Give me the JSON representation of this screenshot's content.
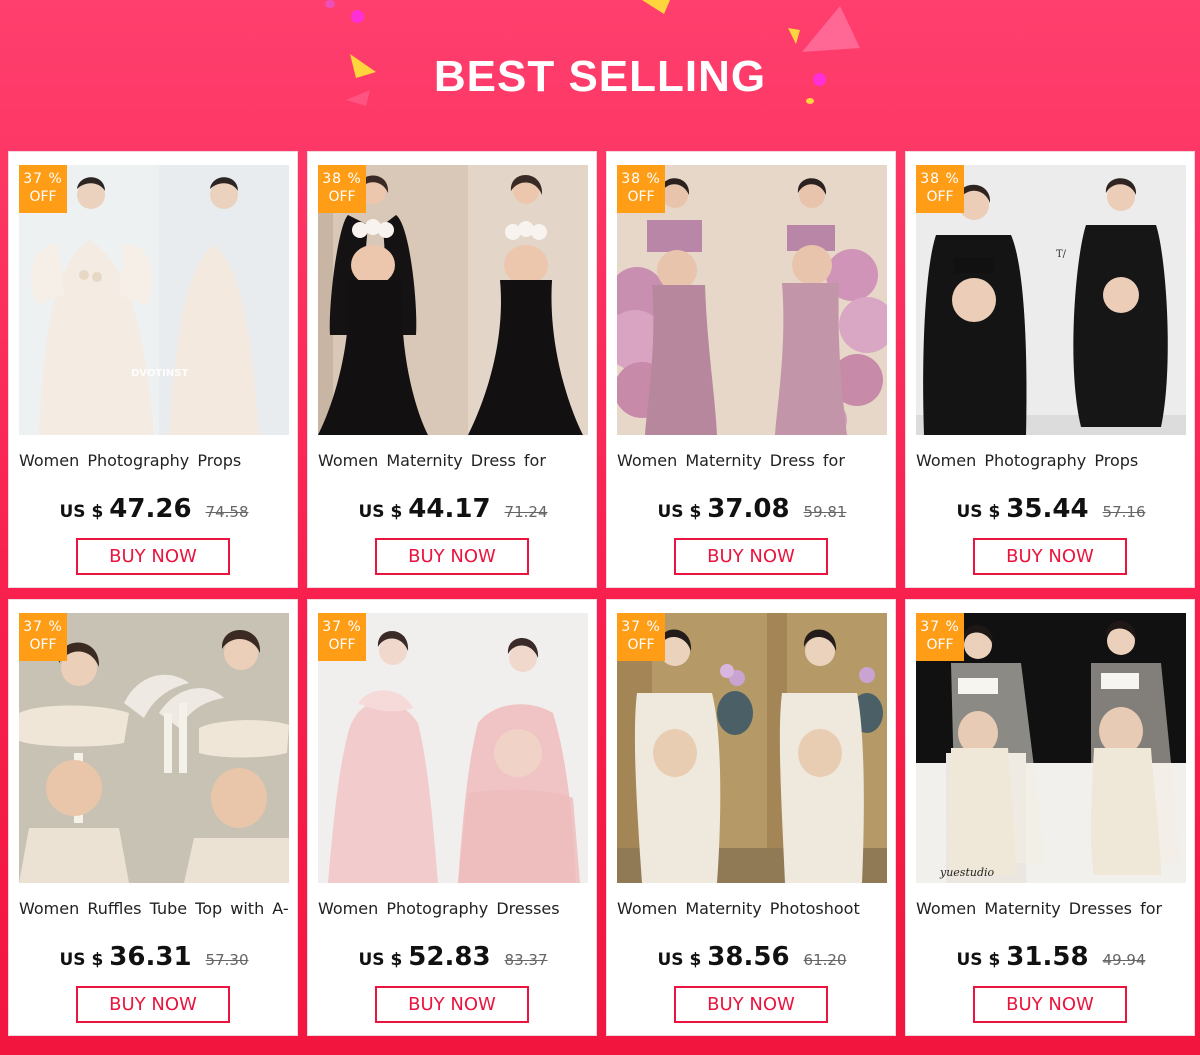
{
  "banner": {
    "title": "BEST SELLING"
  },
  "products": [
    {
      "discount_pct": "37 %",
      "discount_off": "OFF",
      "title": "Women Photography Props",
      "currency": "US $",
      "price": "47.26",
      "old_price": "74.58",
      "buy_label": "BUY NOW",
      "watermark": "DVOTINST",
      "image_desc": "two women in cream tulle gowns"
    },
    {
      "discount_pct": "38 %",
      "discount_off": "OFF",
      "title": "Women Maternity Dress for",
      "currency": "US $",
      "price": "44.17",
      "old_price": "71.24",
      "buy_label": "BUY NOW",
      "image_desc": "two women in black mermaid skirts with floral tops"
    },
    {
      "discount_pct": "38 %",
      "discount_off": "OFF",
      "title": "Women Maternity Dress for",
      "currency": "US $",
      "price": "37.08",
      "old_price": "59.81",
      "buy_label": "BUY NOW",
      "image_desc": "two women in pink chiffon with hydrangeas"
    },
    {
      "discount_pct": "38 %",
      "discount_off": "OFF",
      "title": "Women Photography Props",
      "currency": "US $",
      "price": "35.44",
      "old_price": "57.16",
      "buy_label": "BUY NOW",
      "image_desc": "two women in black suits"
    },
    {
      "discount_pct": "37 %",
      "discount_off": "OFF",
      "title": "Women Ruffles Tube Top with A-",
      "currency": "US $",
      "price": "36.31",
      "old_price": "57.30",
      "buy_label": "BUY NOW",
      "image_desc": "two women in white ruffle tops with candles"
    },
    {
      "discount_pct": "37 %",
      "discount_off": "OFF",
      "title": "Women Photography Dresses",
      "currency": "US $",
      "price": "52.83",
      "old_price": "83.37",
      "buy_label": "BUY NOW",
      "image_desc": "two women in pink tulle dresses"
    },
    {
      "discount_pct": "37 %",
      "discount_off": "OFF",
      "title": "Women Maternity Photoshoot",
      "currency": "US $",
      "price": "38.56",
      "old_price": "61.20",
      "buy_label": "BUY NOW",
      "image_desc": "two women in cream draped gowns"
    },
    {
      "discount_pct": "37 %",
      "discount_off": "OFF",
      "title": "Women Maternity Dresses for",
      "currency": "US $",
      "price": "31.58",
      "old_price": "49.94",
      "buy_label": "BUY NOW",
      "watermark": "yuestudio",
      "image_desc": "two women in white tube tops and capes"
    }
  ],
  "colors": {
    "accent": "#e9153f",
    "badge": "#ff9d17",
    "background": "#f8214f"
  }
}
